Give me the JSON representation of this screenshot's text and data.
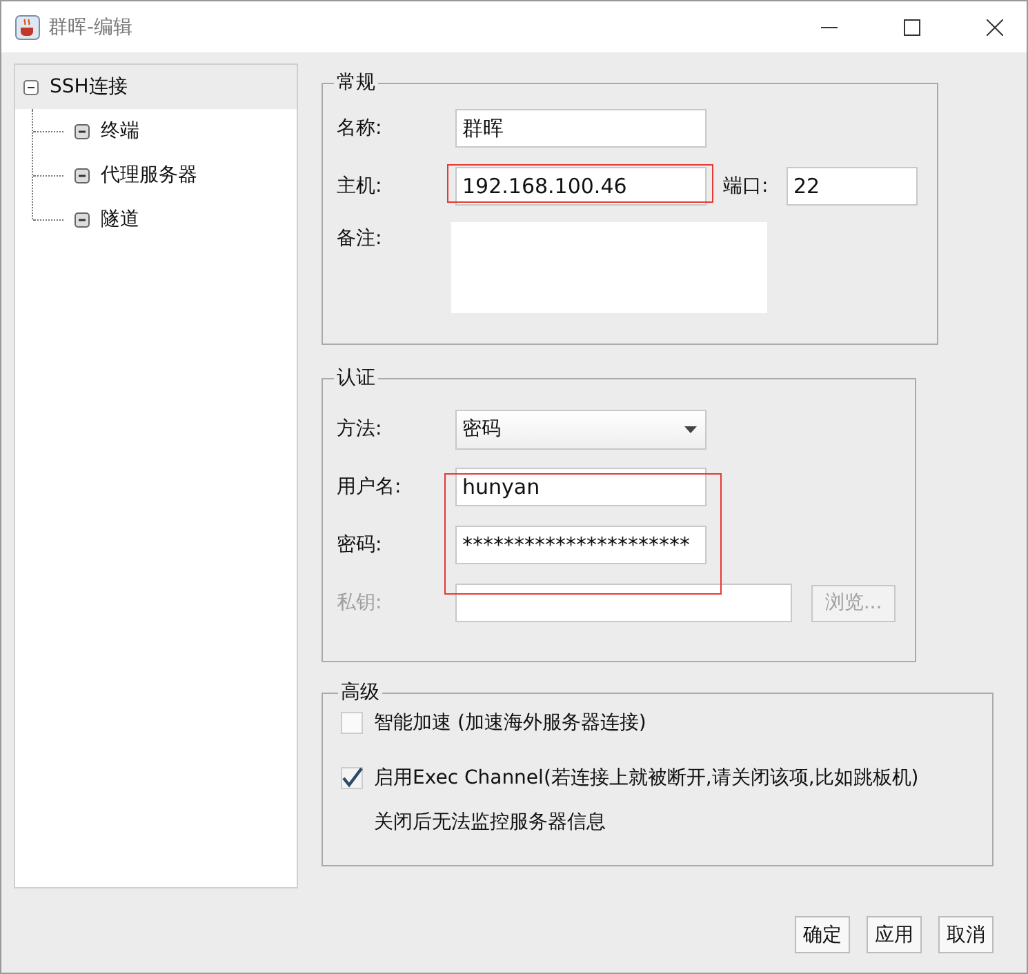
{
  "window": {
    "title": "群晖-编辑"
  },
  "tree": [
    {
      "label": "SSH连接",
      "selected": true,
      "expanded": true,
      "children": [
        {
          "label": "终端",
          "selected": false
        },
        {
          "label": "代理服务器",
          "selected": false
        },
        {
          "label": "隧道",
          "selected": false
        }
      ]
    }
  ],
  "general": {
    "legend": "常规",
    "name_label": "名称:",
    "name_value": "群晖",
    "host_label": "主机:",
    "host_value": "192.168.100.46",
    "host_highlighted": true,
    "port_label": "端口:",
    "port_value": "22",
    "notes_label": "备注:"
  },
  "auth": {
    "legend": "认证",
    "method_label": "方法:",
    "method_value": "密码",
    "credentials_highlighted": true,
    "username_label": "用户名:",
    "username_value": "hunyan",
    "password_label": "密码:",
    "password_value": "**********************",
    "key_label": "私钥:",
    "key_disabled": true,
    "browse_button": "浏览..."
  },
  "advanced": {
    "legend": "高级",
    "options": [
      {
        "label": "智能加速 (加速海外服务器连接)",
        "checked": false
      },
      {
        "label": "启用Exec Channel(若连接上就被断开,请关闭该项,比如跳板机)",
        "checked": true
      }
    ],
    "note": "关闭后无法监控服务器信息"
  },
  "buttons": [
    "确定",
    "应用",
    "取消"
  ]
}
